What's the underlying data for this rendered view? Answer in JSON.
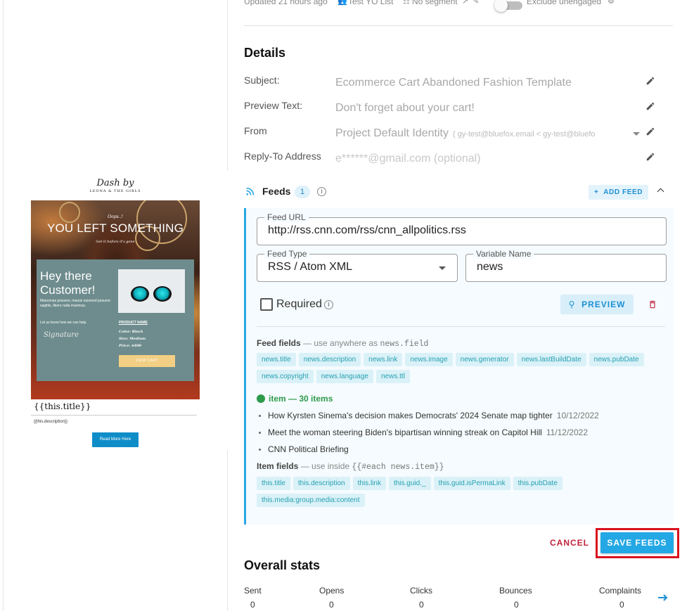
{
  "top_bar": {
    "updated": "Updated 21 hours ago",
    "list": "Test YO List",
    "segment": "No segment",
    "exclude_label": "Exclude unengaged"
  },
  "details": {
    "heading": "Details",
    "rows": [
      {
        "label": "Subject:",
        "value": "Ecommerce Cart Abandoned Fashion Template"
      },
      {
        "label": "Preview Text:",
        "value": "Don't forget about your cart!"
      },
      {
        "label": "From",
        "value": "Project Default Identity",
        "detail": "( gy-test@bluefox.email < gy-test@bluefo"
      },
      {
        "label": "Reply-To Address",
        "value": "e******@gmail.com (optional)"
      }
    ]
  },
  "feeds": {
    "label": "Feeds",
    "count": "1",
    "add_feed": "ADD FEED",
    "feed_url_label": "Feed URL",
    "feed_url": "http://rss.cnn.com/rss/cnn_allpolitics.rss",
    "feed_type_label": "Feed Type",
    "feed_type": "RSS / Atom XML",
    "variable_label": "Variable Name",
    "variable": "news",
    "required_label": "Required",
    "preview_button": "PREVIEW",
    "feed_fields_title": "Feed fields",
    "feed_fields_hint": "— use anywhere as",
    "feed_fields_code": "news.field",
    "feed_fields": [
      "news.title",
      "news.description",
      "news.link",
      "news.image",
      "news.generator",
      "news.lastBuildDate",
      "news.pubDate",
      "news.copyright",
      "news.language",
      "news.ttl"
    ],
    "items_title": "item — 30 items",
    "items": [
      {
        "title": "How Kyrsten Sinema's decision makes Democrats' 2024 Senate map tighter",
        "date": "10/12/2022"
      },
      {
        "title": "Meet the woman steering Biden's bipartisan winning streak on Capitol Hill",
        "date": "11/12/2022"
      },
      {
        "title": "CNN Political Briefing",
        "date": ""
      }
    ],
    "item_fields_title": "Item fields",
    "item_fields_hint": "— use inside",
    "item_fields_code": "{{#each news.item}}",
    "item_fields": [
      "this.title",
      "this.description",
      "this.link",
      "this.guid._",
      "this.guid.isPermaLink",
      "this.pubDate",
      "this.media:group.media:content"
    ]
  },
  "actions": {
    "cancel": "CANCEL",
    "save": "SAVE FEEDS"
  },
  "stats": {
    "heading": "Overall stats",
    "columns": [
      {
        "label": "Sent",
        "value": "0"
      },
      {
        "label": "Opens",
        "value": "0"
      },
      {
        "label": "Clicks",
        "value": "0"
      },
      {
        "label": "Bounces",
        "value": "0"
      },
      {
        "label": "Complaints",
        "value": "0"
      }
    ]
  },
  "email_preview": {
    "logo": "Dash by",
    "logo_sub": "LEONA & THE GIRLS",
    "oops": "Oops..!",
    "heading": "YOU LEFT SOMETHING",
    "subheading": "Get it before it's gone",
    "hey": "Hey there Customer!",
    "body": "Maecenas posuere, mauris euismod posuere sagittis, libero nulla maximus.",
    "let_us_know": "Let us know how we can help.",
    "signature": "Signature",
    "product_name": "PRODUCT NAME",
    "product_meta": [
      "Color: Black",
      "Size: Medium",
      "Price: $400"
    ],
    "view_cart": "VIEW CART",
    "title_placeholder": "{{this.title}}",
    "desc_placeholder": "{{this.description}}",
    "read_more": "Read More Here"
  },
  "colors": {
    "accent": "#24a8e5",
    "danger": "#c0243d",
    "success": "#2e9a4b",
    "highlight_box": "#d8121f"
  }
}
